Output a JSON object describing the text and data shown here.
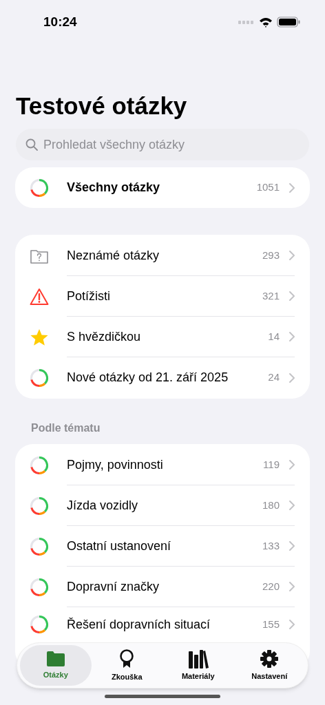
{
  "status_bar": {
    "time": "10:24"
  },
  "title": "Testové otázky",
  "search": {
    "placeholder": "Prohledat všechny otázky"
  },
  "all_questions": {
    "label": "Všechny otázky",
    "count": "1051"
  },
  "collections": [
    {
      "kind": "folder",
      "label": "Neznámé otázky",
      "count": "293"
    },
    {
      "kind": "warning",
      "label": "Potížisti",
      "count": "321"
    },
    {
      "kind": "star",
      "label": "S hvězdičkou",
      "count": "14"
    },
    {
      "kind": "ring",
      "label": "Nové otázky od 21. září 2025",
      "count": "24"
    }
  ],
  "topics": {
    "header": "Podle tématu",
    "items": [
      {
        "label": "Pojmy, povinnosti",
        "count": "119"
      },
      {
        "label": "Jízda vozidly",
        "count": "180"
      },
      {
        "label": "Ostatní ustanovení",
        "count": "133"
      },
      {
        "label": "Dopravní značky",
        "count": "220"
      },
      {
        "label": "Řešení dopravních situací",
        "count": "155"
      }
    ]
  },
  "tab_bar": [
    {
      "kind": "folder",
      "label": "Otázky",
      "selected": true
    },
    {
      "kind": "award",
      "label": "Zkouška",
      "selected": false
    },
    {
      "kind": "books",
      "label": "Materiály",
      "selected": false
    },
    {
      "kind": "gear",
      "label": "Nastavení",
      "selected": false
    }
  ]
}
